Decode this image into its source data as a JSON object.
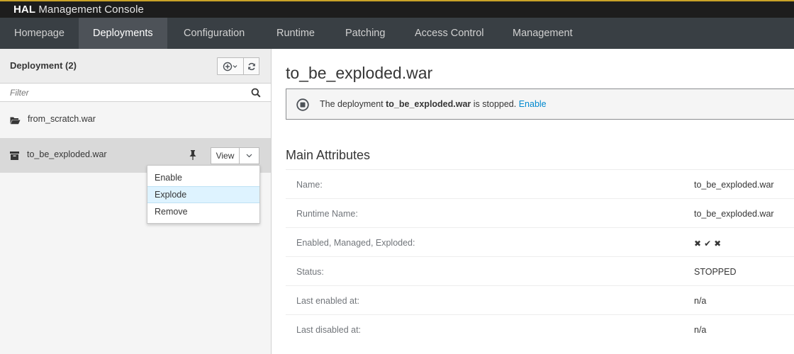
{
  "brand": {
    "bold": "HAL",
    "rest": "Management Console"
  },
  "nav": {
    "items": [
      {
        "label": "Homepage"
      },
      {
        "label": "Deployments",
        "active": true
      },
      {
        "label": "Configuration"
      },
      {
        "label": "Runtime"
      },
      {
        "label": "Patching"
      },
      {
        "label": "Access Control"
      },
      {
        "label": "Management"
      }
    ]
  },
  "left": {
    "title": "Deployment (2)",
    "add_icon": "plus-circle-icon",
    "refresh_icon": "refresh-icon",
    "filter_placeholder": "Filter",
    "items": [
      {
        "label": "from_scratch.war",
        "icon": "folder-open-icon"
      },
      {
        "label": "to_be_exploded.war",
        "icon": "archive-icon",
        "selected": true
      }
    ],
    "view_label": "View",
    "dropdown": [
      {
        "label": "Enable"
      },
      {
        "label": "Explode",
        "hovered": true
      },
      {
        "label": "Remove"
      }
    ]
  },
  "main": {
    "title": "to_be_exploded.war",
    "alert": {
      "prefix": "The deployment ",
      "name": "to_be_exploded.war",
      "suffix": " is stopped. ",
      "link": "Enable"
    },
    "section_title": "Main Attributes",
    "attributes": [
      {
        "key": "Name:",
        "value": "to_be_exploded.war"
      },
      {
        "key": "Runtime Name:",
        "value": "to_be_exploded.war"
      },
      {
        "key": "Enabled, Managed, Exploded:",
        "flags": [
          "✖",
          "✔",
          "✖"
        ]
      },
      {
        "key": "Status:",
        "value": "STOPPED"
      },
      {
        "key": "Last enabled at:",
        "value": "n/a"
      },
      {
        "key": "Last disabled at:",
        "value": "n/a"
      }
    ]
  },
  "colors": {
    "accent": "#0088ce",
    "nav_bg": "#393f44",
    "brand_border": "#c9a227"
  }
}
